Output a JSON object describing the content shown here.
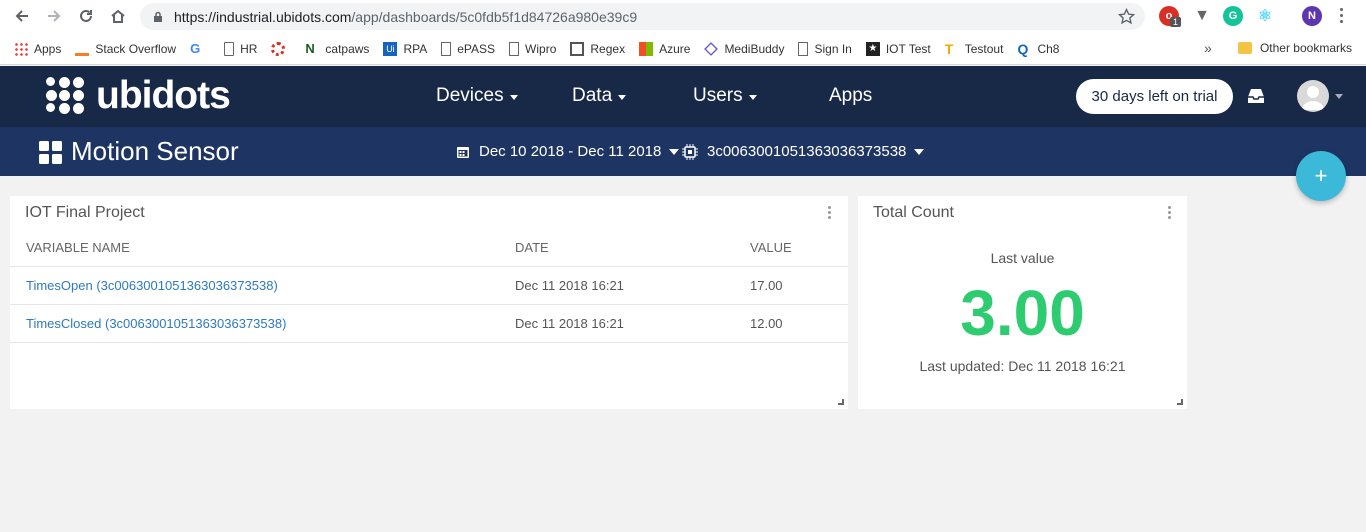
{
  "browser": {
    "url_host": "https://industrial.ubidots.com",
    "url_path": "/app/dashboards/5c0fdb5f1d84726a980e39c9",
    "bookmarks": [
      "Apps",
      "Stack Overflow",
      "HR",
      "catpaws",
      "RPA",
      "ePASS",
      "Wipro",
      "Regex",
      "Azure",
      "MediBuddy",
      "Sign In",
      "IOT Test",
      "Testout",
      "Ch8"
    ],
    "other_bookmarks": "Other bookmarks",
    "profile_initial": "N",
    "badge_count": "1",
    "overflow_label": "»"
  },
  "app": {
    "logo_text": "ubidots",
    "menu": [
      {
        "label": "Devices",
        "has_caret": true
      },
      {
        "label": "Data",
        "has_caret": true
      },
      {
        "label": "Users",
        "has_caret": true
      },
      {
        "label": "Apps",
        "has_caret": false
      }
    ],
    "trial_label": "30 days left on trial",
    "colors": {
      "header": "#182847",
      "subheader": "#1e3563",
      "accent": "#3cb8d8",
      "value": "#2ecc71",
      "link": "#2d79c2"
    }
  },
  "dashboard": {
    "title": "Motion Sensor",
    "date_range": "Dec 10 2018 - Dec 11 2018",
    "device": "3c006300105136303637353​8",
    "fab_label": "+"
  },
  "widgets": {
    "table": {
      "title": "IOT Final Project",
      "headers": [
        "VARIABLE NAME",
        "DATE",
        "VALUE"
      ],
      "rows": [
        {
          "name": "TimesOpen (3c0063001051363036373538)",
          "date": "Dec 11 2018 16:21",
          "value": "17.00"
        },
        {
          "name": "TimesClosed (3c0063001051363036373538)",
          "date": "Dec 11 2018 16:21",
          "value": "12.00"
        }
      ]
    },
    "metric": {
      "title": "Total Count",
      "label": "Last value",
      "value": "3.00",
      "updated": "Last updated: Dec 11 2018 16:21"
    }
  }
}
